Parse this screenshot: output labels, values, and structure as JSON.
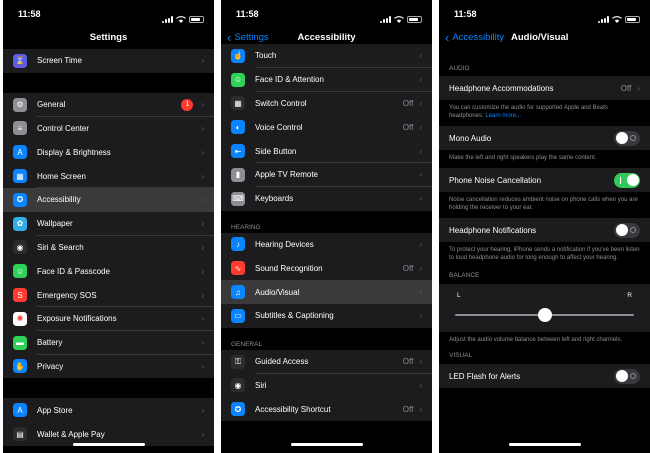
{
  "status": {
    "time": "11:58"
  },
  "panel1": {
    "title": "Settings",
    "group0": [
      {
        "label": "Screen Time",
        "icon": "hourglass-icon",
        "color": "#5e5ce6"
      }
    ],
    "group1": [
      {
        "label": "General",
        "icon": "gear-icon",
        "color": "#8e8e93",
        "badge": "1"
      },
      {
        "label": "Control Center",
        "icon": "switches-icon",
        "color": "#8e8e93"
      },
      {
        "label": "Display & Brightness",
        "icon": "text-size-icon",
        "color": "#0a84ff"
      },
      {
        "label": "Home Screen",
        "icon": "grid-icon",
        "color": "#0a84ff"
      },
      {
        "label": "Accessibility",
        "icon": "accessibility-icon",
        "color": "#0a84ff"
      },
      {
        "label": "Wallpaper",
        "icon": "flower-icon",
        "color": "#32ade6"
      },
      {
        "label": "Siri & Search",
        "icon": "siri-icon",
        "color": "#2c2c2e"
      },
      {
        "label": "Face ID & Passcode",
        "icon": "face-id-icon",
        "color": "#30d158"
      },
      {
        "label": "Emergency SOS",
        "icon": "sos-icon",
        "color": "#ff3b30"
      },
      {
        "label": "Exposure Notifications",
        "icon": "exposure-icon",
        "color": "#ffffff"
      },
      {
        "label": "Battery",
        "icon": "battery-icon",
        "color": "#30d158"
      },
      {
        "label": "Privacy",
        "icon": "hand-icon",
        "color": "#0a84ff"
      }
    ],
    "group2": [
      {
        "label": "App Store",
        "icon": "app-store-icon",
        "color": "#0a84ff"
      },
      {
        "label": "Wallet & Apple Pay",
        "icon": "wallet-icon",
        "color": "#2c2c2e"
      }
    ]
  },
  "panel2": {
    "back": "Settings",
    "title": "Accessibility",
    "group1": [
      {
        "label": "Touch",
        "icon": "touch-icon",
        "color": "#0a84ff"
      },
      {
        "label": "Face ID & Attention",
        "icon": "face-id-icon",
        "color": "#30d158"
      },
      {
        "label": "Switch Control",
        "icon": "switch-grid-icon",
        "color": "#2c2c2e",
        "value": "Off"
      },
      {
        "label": "Voice Control",
        "icon": "voice-control-icon",
        "color": "#0a84ff",
        "value": "Off"
      },
      {
        "label": "Side Button",
        "icon": "side-button-icon",
        "color": "#0a84ff"
      },
      {
        "label": "Apple TV Remote",
        "icon": "remote-icon",
        "color": "#8e8e93"
      },
      {
        "label": "Keyboards",
        "icon": "keyboard-icon",
        "color": "#8e8e93"
      }
    ],
    "hearing_header": "HEARING",
    "group2": [
      {
        "label": "Hearing Devices",
        "icon": "ear-icon",
        "color": "#0a84ff"
      },
      {
        "label": "Sound Recognition",
        "icon": "waveform-icon",
        "color": "#ff3b30",
        "value": "Off"
      },
      {
        "label": "Audio/Visual",
        "icon": "audio-visual-icon",
        "color": "#0a84ff"
      },
      {
        "label": "Subtitles & Captioning",
        "icon": "captions-icon",
        "color": "#0a84ff"
      }
    ],
    "general_header": "GENERAL",
    "group3": [
      {
        "label": "Guided Access",
        "icon": "lock-icon",
        "color": "#2c2c2e",
        "value": "Off"
      },
      {
        "label": "Siri",
        "icon": "siri-icon",
        "color": "#2c2c2e"
      },
      {
        "label": "Accessibility Shortcut",
        "icon": "accessibility-icon",
        "color": "#0a84ff",
        "value": "Off"
      }
    ]
  },
  "panel3": {
    "back": "Accessibility",
    "title": "Audio/Visual",
    "audio_header": "AUDIO",
    "headphone_accommodations": {
      "label": "Headphone Accommodations",
      "value": "Off"
    },
    "headphone_note": "You can customize the audio for supported Apple and Beats headphones.",
    "learn_more": "Learn more...",
    "mono_audio": {
      "label": "Mono Audio",
      "on": false
    },
    "mono_note": "Make the left and right speakers play the same content.",
    "noise_cancellation": {
      "label": "Phone Noise Cancellation",
      "on": true
    },
    "noise_note": "Noise cancellation reduces ambient noise on phone calls when you are holding the receiver to your ear.",
    "headphone_notifications": {
      "label": "Headphone Notifications",
      "on": false
    },
    "notifications_note": "To protect your hearing, iPhone sends a notification if you've been listen to loud headphone audio for long enough to affect your hearing.",
    "balance_header": "BALANCE",
    "balance": {
      "left": "L",
      "right": "R",
      "value": 0.5
    },
    "balance_note": "Adjust the audio volume balance between left and right channels.",
    "visual_header": "VISUAL",
    "led_flash": {
      "label": "LED Flash for Alerts",
      "on": false
    }
  }
}
